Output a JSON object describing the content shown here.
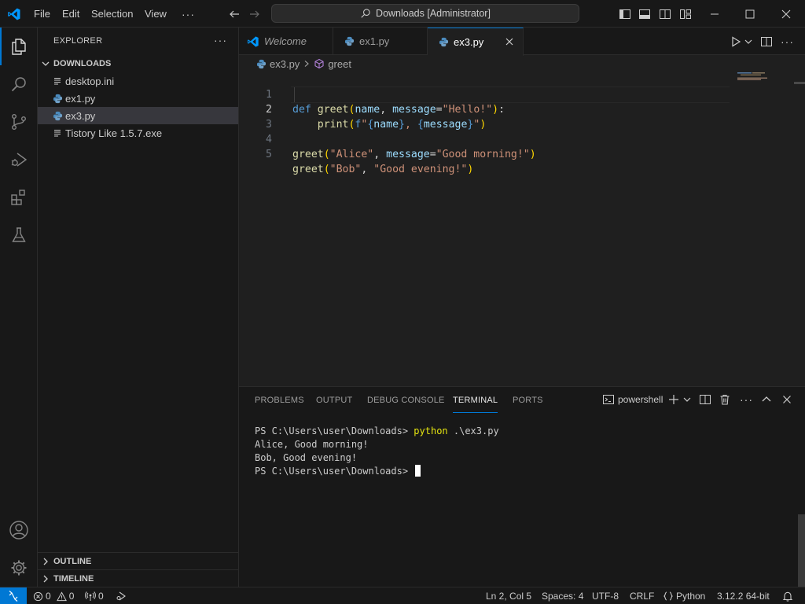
{
  "titlebar": {
    "menu": [
      "File",
      "Edit",
      "Selection",
      "View"
    ],
    "more": "···",
    "command_center": "Downloads [Administrator]"
  },
  "activity": [
    "explorer-icon",
    "search-icon",
    "source-control-icon",
    "run-debug-icon",
    "extensions-icon",
    "testing-icon",
    "account-icon",
    "settings-icon"
  ],
  "sidebar": {
    "title": "EXPLORER",
    "more": "···",
    "folder": "DOWNLOADS",
    "files": [
      {
        "name": "desktop.ini",
        "icon": "text-file-icon"
      },
      {
        "name": "ex1.py",
        "icon": "python-file-icon"
      },
      {
        "name": "ex3.py",
        "icon": "python-file-icon",
        "selected": true
      },
      {
        "name": "Tistory Like 1.5.7.exe",
        "icon": "text-file-icon"
      }
    ],
    "outline": "OUTLINE",
    "timeline": "TIMELINE"
  },
  "tabs": [
    {
      "label": "Welcome",
      "active": false
    },
    {
      "label": "ex1.py",
      "active": false
    },
    {
      "label": "ex3.py",
      "active": true
    }
  ],
  "breadcrumb": {
    "file": "ex3.py",
    "symbol": "greet"
  },
  "editor": {
    "line_numbers": [
      "1",
      "2",
      "3",
      "4",
      "5"
    ],
    "current_line": 2,
    "tokens": {
      "l1": [
        "def",
        "greet",
        "(",
        "name",
        ", ",
        "message",
        "=",
        "\"Hello!\"",
        ")",
        ":"
      ],
      "l2": [
        "print",
        "(",
        "f\"",
        "{",
        "name",
        "}",
        ", ",
        "{",
        "message",
        "}",
        "\"",
        ")"
      ],
      "l4": [
        "greet",
        "(",
        "\"Alice\"",
        ", ",
        "message",
        "=",
        "\"Good morning!\"",
        ")"
      ],
      "l5": [
        "greet",
        "(",
        "\"Bob\"",
        ", ",
        "\"Good evening!\"",
        ")"
      ]
    }
  },
  "panel": {
    "tabs": [
      "PROBLEMS",
      "OUTPUT",
      "DEBUG CONSOLE",
      "TERMINAL",
      "PORTS"
    ],
    "active_tab": "TERMINAL",
    "shell": "powershell",
    "terminal": {
      "prompt": "PS C:\\Users\\user\\Downloads> ",
      "command": "python",
      "args": " .\\ex3.py",
      "output": [
        "Alice, Good morning!",
        "Bob, Good evening!"
      ]
    }
  },
  "statusbar": {
    "errors": "0",
    "warnings": "0",
    "ports": "0",
    "position": "Ln 2, Col 5",
    "spaces": "Spaces: 4",
    "encoding": "UTF-8",
    "eol": "CRLF",
    "language": "Python",
    "interpreter": "3.12.2 64-bit"
  },
  "colors": {
    "accent": "#0078d4",
    "keyword": "#569cd6",
    "function": "#dcdcaa",
    "string": "#ce9178",
    "parameter": "#9cdcfe"
  }
}
